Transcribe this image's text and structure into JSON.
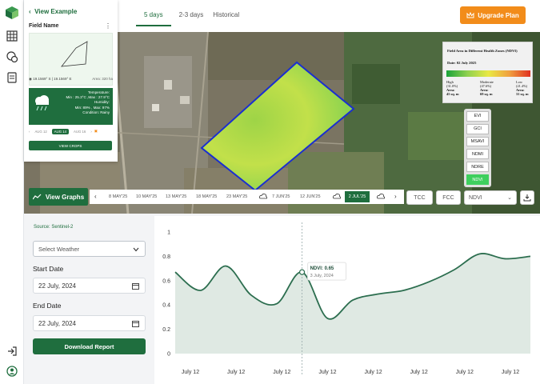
{
  "nav": {
    "back_label": "View Example",
    "tabs": [
      {
        "label": "5 days",
        "active": true
      },
      {
        "label": "2-3 days",
        "active": false
      },
      {
        "label": "Historical",
        "active": false
      }
    ],
    "upgrade_label": "Upgrade Plan"
  },
  "field": {
    "name": "Field Name",
    "coords": "19.1569° S | 19.1569° E",
    "area": "Area: 320 ha",
    "weather": {
      "title": "Temperature:",
      "minmax": "Min : 25.3°C ,Max : 27.9°C",
      "humidity_title": "Humidity:",
      "humidity": "Min: 89% , Max: 97%",
      "condition": "Condition: Rainy"
    },
    "dates": [
      "AUG 12",
      "AUG 14",
      "AUG 16"
    ],
    "selected_date": "AUG 14",
    "view_crops_label": "VIEW CROPS"
  },
  "legend": {
    "title": "Field Area in Different Health Zones (NDVI)",
    "date": "Date: 02 July 2025",
    "zones": [
      {
        "name": "High",
        "pct": "(31.0%)",
        "area_label": "Area:",
        "area": "45 sq. m"
      },
      {
        "name": "Moderate",
        "pct": "(47.6%)",
        "area_label": "Area:",
        "area": "69 sq. m"
      },
      {
        "name": "Low",
        "pct": "(21.4%)",
        "area_label": "Area:",
        "area": "31 sq. m"
      }
    ],
    "colors": {
      "high": "#1aa33a",
      "moderate": "#e9e944",
      "low": "#e03020"
    }
  },
  "indices": [
    "EVI",
    "GCI",
    "MSAVI",
    "NDMI",
    "NDRE",
    "NDVI"
  ],
  "selected_index": "NDVI",
  "timeline": {
    "view_graphs_label": "View Graphs",
    "dates": [
      "8 MAY'25",
      "10 MAY'25",
      "13 MAY'25",
      "18 MAY'25",
      "23 MAY'25",
      "7 JUN'25",
      "12 JUN'25",
      "2 JUL'25"
    ],
    "selected": "2 JUL'25",
    "tcc_label": "TCC",
    "fcc_label": "FCC",
    "index_select": "NDVI"
  },
  "panel": {
    "source": "Source: Sentinel-2",
    "weather_placeholder": "Select Weather",
    "start_label": "Start Date",
    "start_value": "22 July, 2024",
    "end_label": "End Date",
    "end_value": "22 July, 2024",
    "download_label": "Download Report"
  },
  "chart_data": {
    "type": "area",
    "x": [
      "July 12",
      "July 12",
      "July 12",
      "July 12",
      "July 12",
      "July 12",
      "July 12",
      "July 12"
    ],
    "series": [
      {
        "values": [
          0.67,
          0.52,
          0.72,
          0.48,
          0.41,
          0.67,
          0.29,
          0.44,
          0.49,
          0.52,
          0.59,
          0.69,
          0.82,
          0.78,
          0.8
        ]
      }
    ],
    "ylim": [
      0,
      1
    ],
    "yticks": [
      0,
      0.2,
      0.4,
      0.6,
      0.8,
      1
    ],
    "tooltip": {
      "label": "NDVI: 0.65",
      "date": "3 July, 2024"
    },
    "grid": false
  }
}
